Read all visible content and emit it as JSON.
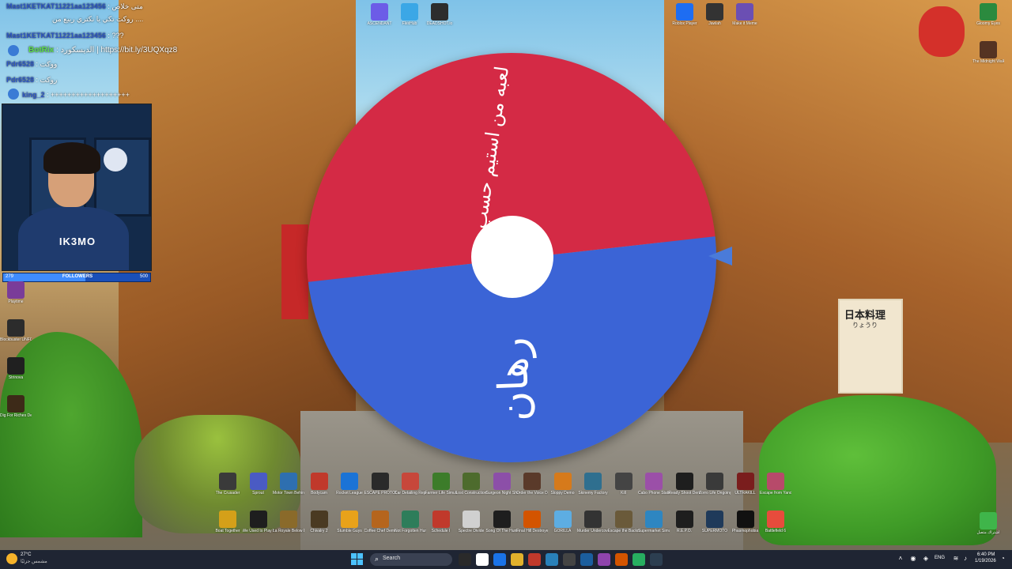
{
  "wheel": {
    "segments": [
      {
        "label": "لعبه من استيم حسب...",
        "color": "#d42a45"
      },
      {
        "label": "رهان",
        "color": "#3b64d6"
      }
    ],
    "pointer_color": "#4a7bd9"
  },
  "poster": {
    "title": "日本料理",
    "subtitle": "りょうり"
  },
  "chat": {
    "messages": [
      {
        "user": "Mast1KETKAT11221aa123456",
        "text": "متى خلاص"
      },
      {
        "user": "",
        "text": "روكت تكي يا نكتري ربيع من ...."
      },
      {
        "user": "Mast1KETKAT11221aa123456",
        "text": "???"
      },
      {
        "user": "BotRix",
        "text": ": الديسكورد | https://bit.ly/3UQXqz8"
      },
      {
        "user": "Pdr6528",
        "text": "ووكت"
      },
      {
        "user": "Pdr6528",
        "text": "روكت"
      },
      {
        "user": "king_2",
        "text": "+++++++++++++++++++"
      }
    ]
  },
  "camera": {
    "logo": "IK3MO"
  },
  "followers": {
    "label": "FOLLOWERS",
    "current": "279",
    "goal": "500",
    "progress": 0.558
  },
  "desktop_left": [
    {
      "label": "Playtime",
      "color": "#7a3c99"
    },
    {
      "label": "Blockbuster UNFOLD",
      "color": "#2c2c2c"
    },
    {
      "label": "Strinova",
      "color": "#202020"
    },
    {
      "label": "Dig For Riches Demo",
      "color": "#3d2a18"
    }
  ],
  "desktop_top": [
    {
      "label": "ASCENDANT",
      "color": "#6c5ce7"
    },
    {
      "label": "FlexHub",
      "color": "#3ba7e6"
    },
    {
      "label": "DEADSHOT.io",
      "color": "#2d2d2d"
    }
  ],
  "desktop_top_right": [
    {
      "label": "Roblox Player",
      "color": "#1e6df2"
    },
    {
      "label": "Jawlah",
      "color": "#333333"
    },
    {
      "label": "Make it Meme",
      "color": "#6b4fb3"
    }
  ],
  "desktop_right": [
    {
      "label": "Gloomy Eyes",
      "color": "#2b8a3e"
    },
    {
      "label": "The Midnight Walk",
      "color": "#553322"
    }
  ],
  "desktop_row1": [
    {
      "label": "The Crusader",
      "color": "#3a3a3a"
    },
    {
      "label": "Sprout",
      "color": "#4a5bc4"
    },
    {
      "label": "Motor Town Behind Th...",
      "color": "#2e6fb0"
    },
    {
      "label": "Bodycam",
      "color": "#c0392b"
    },
    {
      "label": "Rocket League",
      "color": "#1b73d6"
    },
    {
      "label": "ESCAPE PROTOCOL",
      "color": "#2a2a2a"
    },
    {
      "label": "Car Detailing Repair Demo",
      "color": "#c7473b"
    },
    {
      "label": "Farmer Life Simulator",
      "color": "#3c7c2a"
    },
    {
      "label": "Lost Construction",
      "color": "#4d6b2d"
    },
    {
      "label": "Surgeon Night Shift",
      "color": "#8c4fa8"
    },
    {
      "label": "Order the Voice Demo",
      "color": "#5a3a2a"
    },
    {
      "label": "Sloppy Demo",
      "color": "#d67a1b"
    },
    {
      "label": "Skinemy Factory",
      "color": "#2f6f8f"
    },
    {
      "label": "Kill",
      "color": "#444444"
    },
    {
      "label": "Cabo Phone Station",
      "color": "#9b4fa8"
    },
    {
      "label": "Ready Shoot Demo",
      "color": "#1e1e1e"
    },
    {
      "label": "Zorro Life Ongoing",
      "color": "#3a3a3a"
    },
    {
      "label": "ULTRAKILL",
      "color": "#7a1d1d"
    },
    {
      "label": "Escape from Yandere Demo",
      "color": "#b74a6a"
    }
  ],
  "desktop_row2": [
    {
      "label": "Boat Together",
      "color": "#d4a019"
    },
    {
      "label": "We Used to Play Here",
      "color": "#1e1e1e"
    },
    {
      "label": "La Royale Below Dead",
      "color": "#8a6a2a"
    },
    {
      "label": "Chivalry 2",
      "color": "#4a3a22"
    },
    {
      "label": "Stumble Guys",
      "color": "#e8a21a"
    },
    {
      "label": "Coffee Chef Demo",
      "color": "#b5651d"
    },
    {
      "label": "Not Forgotten Hunted",
      "color": "#2e7d5a"
    },
    {
      "label": "Schedule I",
      "color": "#c0392b"
    },
    {
      "label": "Spectre Divide",
      "color": "#d0d0d0"
    },
    {
      "label": "Song Of The Hunt",
      "color": "#1e1e1e"
    },
    {
      "label": "Final Hill Destroyer",
      "color": "#d35400"
    },
    {
      "label": "GORILLA",
      "color": "#5dade2"
    },
    {
      "label": "Murder Undercover",
      "color": "#333333"
    },
    {
      "label": "Escape the Backrooms",
      "color": "#6a5a3a"
    },
    {
      "label": "Supermarket Simulator",
      "color": "#2e86c1"
    },
    {
      "label": "R.E.P.O.",
      "color": "#1e1e1e"
    },
    {
      "label": "SUPERMOTO",
      "color": "#1f3a5a"
    },
    {
      "label": "Phasmophobia",
      "color": "#111111"
    },
    {
      "label": "Battlefield 6",
      "color": "#e74c3c"
    }
  ],
  "desktop_corner": {
    "label": "اشتراك متصل",
    "color": "#3fb54a"
  },
  "taskbar": {
    "weather_temp": "27°C",
    "weather_desc": "مشمس جزئيًا",
    "search_placeholder": "Search",
    "apps": [
      "#2a2a2a",
      "#ffffff",
      "#1a73e8",
      "#e1b12c",
      "#c0392b",
      "#2980b9",
      "#444444",
      "#1b5e9e",
      "#8e44ad",
      "#d35400",
      "#27ae60",
      "#2c3e50"
    ],
    "lang": "ENG",
    "time": "6:40 PM",
    "date": "1/19/2026"
  }
}
